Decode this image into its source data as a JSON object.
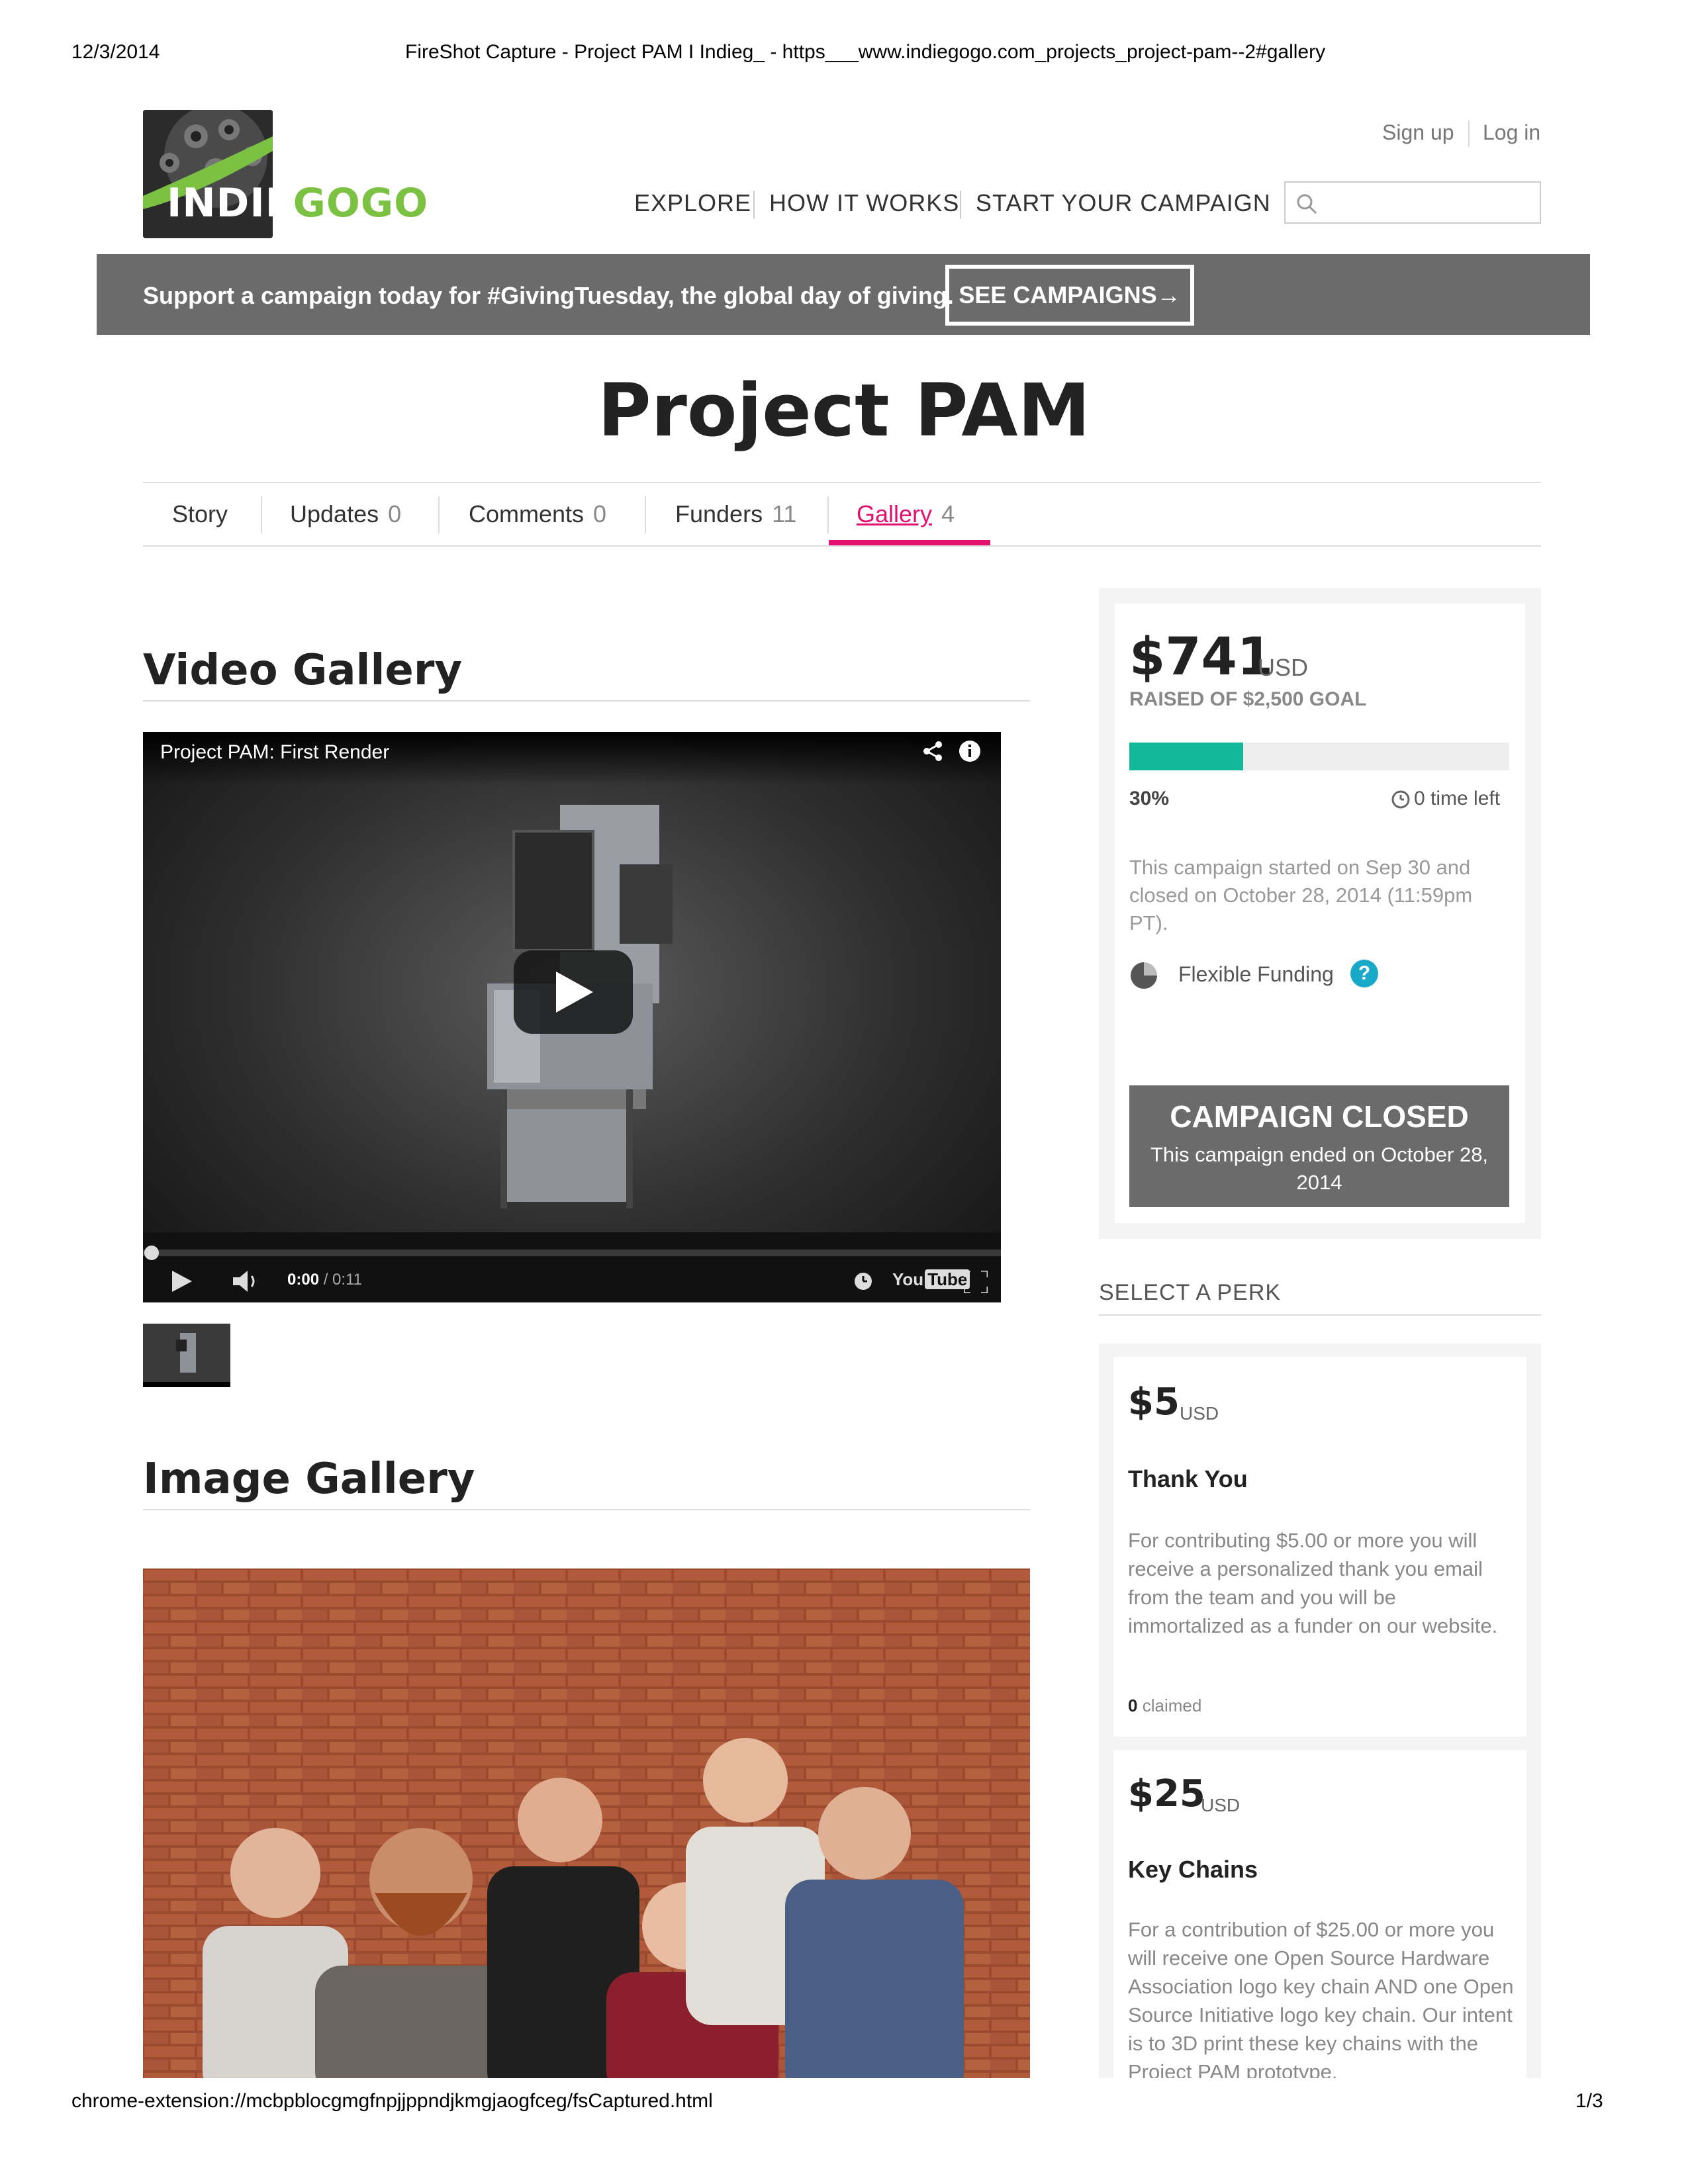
{
  "print_header": {
    "date": "12/3/2014",
    "title": "FireShot Capture - Project PAM I Indieg_ - https___www.indiegogo.com_projects_project-pam--2#gallery"
  },
  "print_footer": {
    "url": "chrome-extension://mcbpblocgmgfnpjjppndjkmgjaogfceg/fsCaptured.html",
    "page": "1/3"
  },
  "logo": {
    "part1": "INDIE",
    "part2": "GOGO"
  },
  "top_links": {
    "signup": "Sign up",
    "login": "Log in"
  },
  "nav": {
    "explore": "EXPLORE",
    "how": "HOW IT WORKS",
    "start": "START YOUR CAMPAIGN"
  },
  "search": {
    "placeholder": ""
  },
  "banner": {
    "text": "Support a campaign today for #GivingTuesday, the global day of giving.",
    "button": "SEE CAMPAIGNS→"
  },
  "project_title": "Project PAM",
  "tabs": [
    {
      "label": "Story",
      "count": ""
    },
    {
      "label": "Updates",
      "count": "0"
    },
    {
      "label": "Comments",
      "count": "0"
    },
    {
      "label": "Funders",
      "count": "11"
    },
    {
      "label": "Gallery",
      "count": "4"
    }
  ],
  "video_gallery": {
    "title": "Video Gallery",
    "video_title": "Project PAM: First Render",
    "time_current": "0:00",
    "time_total": "/ 0:11",
    "youtube": "You"
  },
  "image_gallery": {
    "title": "Image Gallery"
  },
  "campaign": {
    "amount": "$741",
    "currency": "USD",
    "raised_of": "RAISED OF $2,500 GOAL",
    "percent": "30%",
    "progress": 0.3,
    "time_left": "0 time left",
    "dates_text": "This campaign started on Sep 30 and closed on October 28, 2014 (11:59pm PT).",
    "funding_type": "Flexible Funding",
    "help": "?",
    "closed_title": "CAMPAIGN CLOSED",
    "closed_text": "This campaign ended on October 28, 2014"
  },
  "perks": {
    "header": "SELECT A PERK",
    "items": [
      {
        "amount": "$5",
        "currency": "USD",
        "title": "Thank You",
        "description": "For contributing $5.00 or more you will receive a personalized thank you email from the team and you will be immortalized as a funder on our website.",
        "claimed_count": "0",
        "claimed_label": "claimed"
      },
      {
        "amount": "$25",
        "currency": "USD",
        "title": "Key Chains",
        "description": "For a contribution of $25.00 or more you will receive one Open Source Hardware Association logo key chain AND one Open Source Initiative logo key chain. Our intent is to 3D print these key chains with the Project PAM prototype."
      }
    ]
  },
  "colors": {
    "accent_pink": "#e2106e",
    "progress_teal": "#13b89a",
    "logo_green": "#7cc242",
    "banner_gray": "#6b6b6b",
    "help_teal": "#18a8c8"
  }
}
